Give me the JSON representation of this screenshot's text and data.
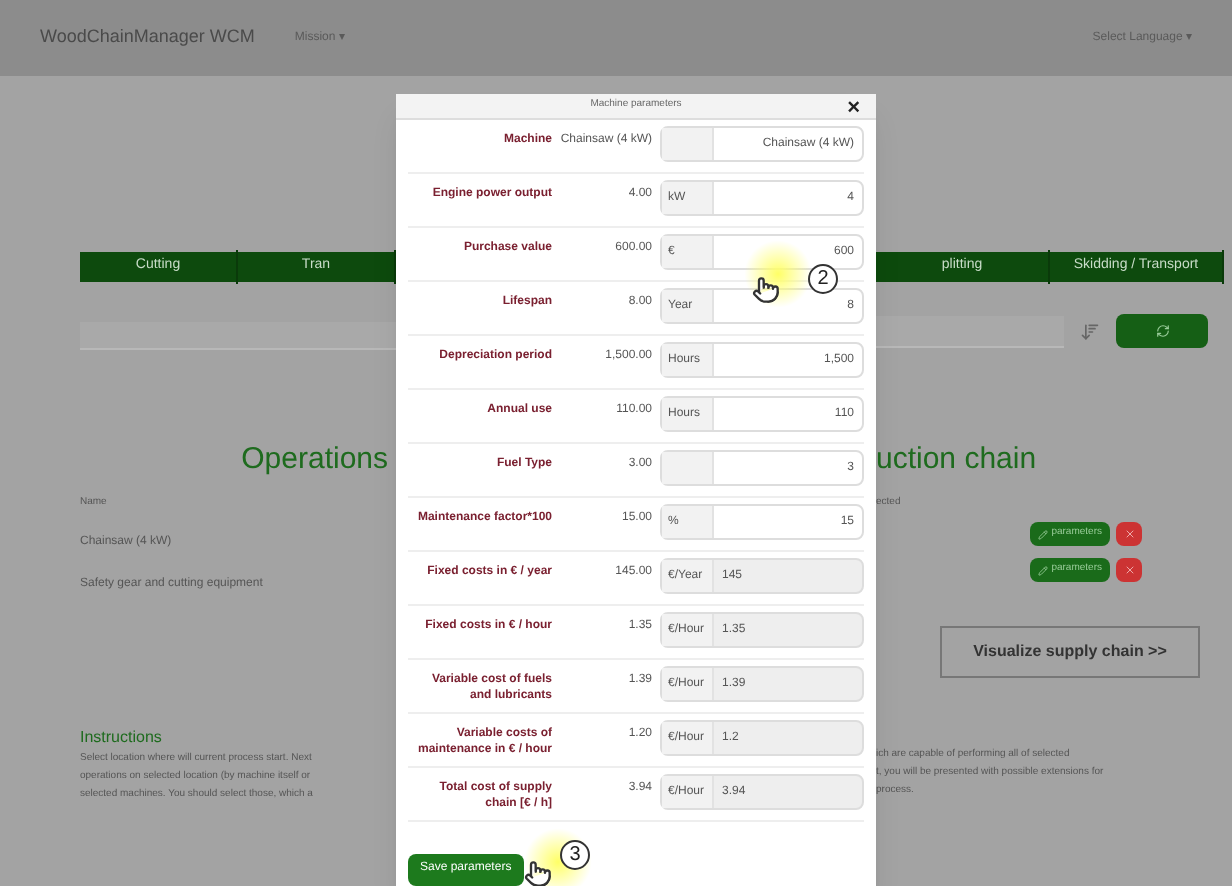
{
  "navbar": {
    "brand": "WoodChainManager WCM",
    "menu": "Mission ▾",
    "language": "Select Language ▾"
  },
  "tabs_left": [
    {
      "label": "Cutting",
      "selected": false
    },
    {
      "label": "Tran",
      "selected": false
    }
  ],
  "tabs_right": [
    {
      "label": "plitting",
      "selected": false
    },
    {
      "label": "Skidding / Transport",
      "selected": false
    }
  ],
  "heading": {
    "left": "Operations",
    "right": "uction chain"
  },
  "table": {
    "column_left": "Name",
    "column_right": "ected",
    "rows": [
      {
        "name": "Chainsaw (4 kW)",
        "parameters": "parameters"
      },
      {
        "name": "Safety gear and cutting equipment",
        "parameters": "parameters"
      }
    ]
  },
  "visualize_button": "Visualize supply chain >>",
  "instructions": {
    "title": "Instructions",
    "left_lines": [
      "Select location where will current process start. Next",
      "operations on selected location (by machine itself or",
      "selected machines. You should select those, which a"
    ],
    "right_lines": [
      "ich are capable of performing all of selected",
      "t, you will be presented with possible extensions for",
      "process."
    ]
  },
  "modal": {
    "title": "Machine parameters",
    "close": "×",
    "rows": [
      {
        "label": "Machine",
        "value": "Chainsaw (4 kW)",
        "unit": "",
        "input": "Chainsaw (4 kW)",
        "disabled": false
      },
      {
        "label": "Engine power output",
        "value": "4.00",
        "unit": "kW",
        "input": "4",
        "disabled": false
      },
      {
        "label": "Purchase value",
        "value": "600.00",
        "unit": "€",
        "input": "600",
        "disabled": false
      },
      {
        "label": "Lifespan",
        "value": "8.00",
        "unit": "Year",
        "input": "8",
        "disabled": false
      },
      {
        "label": "Depreciation period",
        "value": "1,500.00",
        "unit": "Hours",
        "input": "1,500",
        "disabled": false
      },
      {
        "label": "Annual use",
        "value": "110.00",
        "unit": "Hours",
        "input": "110",
        "disabled": false
      },
      {
        "label": "Fuel Type",
        "value": "3.00",
        "unit": "",
        "input": "3",
        "disabled": false
      },
      {
        "label": "Maintenance factor*100",
        "value": "15.00",
        "unit": "%",
        "input": "15",
        "disabled": false
      },
      {
        "label": "Fixed costs in € / year",
        "value": "145.00",
        "unit": "€/Year",
        "input": "145",
        "disabled": true
      },
      {
        "label": "Fixed costs in € / hour",
        "value": "1.35",
        "unit": "€/Hour",
        "input": "1.35",
        "disabled": true
      },
      {
        "label": "Variable cost of fuels and lubricants",
        "value": "1.39",
        "unit": "€/Hour",
        "input": "1.39",
        "disabled": true
      },
      {
        "label": "Variable costs of maintenance in € / hour",
        "value": "1.20",
        "unit": "€/Hour",
        "input": "1.2",
        "disabled": true
      },
      {
        "label": "Total cost of supply chain [€ / h]",
        "value": "3.94",
        "unit": "€/Hour",
        "input": "3.94",
        "disabled": true
      }
    ],
    "save_button": "Save parameters"
  },
  "tutorial_markers": [
    {
      "label": "2"
    },
    {
      "label": "3"
    }
  ]
}
